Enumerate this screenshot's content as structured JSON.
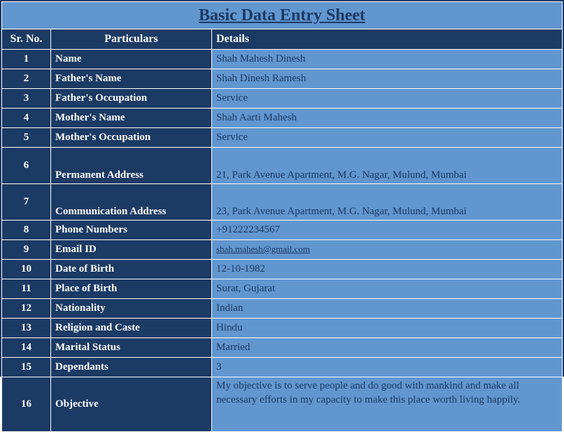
{
  "title": "Basic Data Entry Sheet",
  "columns": {
    "sr": "Sr. No.",
    "part": "Particulars",
    "det": "Details"
  },
  "rows": [
    {
      "n": "1",
      "p": "Name",
      "d": "Shah Mahesh Dinesh",
      "cls": "normal"
    },
    {
      "n": "2",
      "p": "Father's Name",
      "d": "Shah Dinesh Ramesh",
      "cls": "normal"
    },
    {
      "n": "3",
      "p": "Father's Occupation",
      "d": "Service",
      "cls": "normal"
    },
    {
      "n": "4",
      "p": "Mother's Name",
      "d": "Shah Aarti Mahesh",
      "cls": "normal"
    },
    {
      "n": "5",
      "p": "Mother's Occupation",
      "d": "Service",
      "cls": "normal"
    },
    {
      "n": "6",
      "p": "Permanent Address",
      "d": "21, Park Avenue Apartment, M.G. Nagar, Mulund, Mumbai",
      "cls": "tall"
    },
    {
      "n": "7",
      "p": "Communication Address",
      "d": "23, Park Avenue Apartment, M.G. Nagar, Mulund, Mumbai",
      "cls": "tall"
    },
    {
      "n": "8",
      "p": "Phone Numbers",
      "d": "+91222234567",
      "cls": "normal"
    },
    {
      "n": "9",
      "p": "Email ID",
      "d": "shah.mahesh@gmail.com",
      "cls": "normal",
      "email": true
    },
    {
      "n": "10",
      "p": "Date of Birth",
      "d": "12-10-1982",
      "cls": "normal"
    },
    {
      "n": "11",
      "p": "Place of Birth",
      "d": "Surat, Gujarat",
      "cls": "normal"
    },
    {
      "n": "12",
      "p": "Nationality",
      "d": "Indian",
      "cls": "normal"
    },
    {
      "n": "13",
      "p": "Religion and Caste",
      "d": "Hindu",
      "cls": "normal"
    },
    {
      "n": "14",
      "p": "Marital Status",
      "d": "Married",
      "cls": "normal"
    },
    {
      "n": "15",
      "p": "Dependants",
      "d": "3",
      "cls": "normal"
    },
    {
      "n": "16",
      "p": "Objective",
      "d": "My objective is to serve people and do good with mankind and make all necessary efforts in my capacity to make this place worth living happily.",
      "cls": "objective"
    }
  ]
}
